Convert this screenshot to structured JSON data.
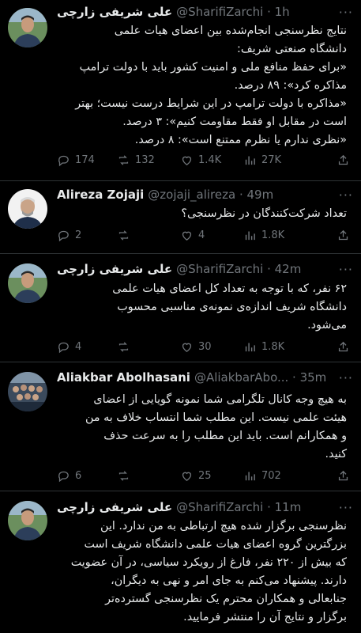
{
  "tweets": [
    {
      "name": "علی شریفی زارچی",
      "handle": "@SharifiZarchi · 1h",
      "text": "نتایج نظرسنجی انجام‌شده بین اعضای هیات علمی\nدانشگاه صنعتی شریف:\n«برای حفظ منافع ملی و امنیت کشور باید با دولت ترامپ\nمذاکره کرد»: ۸۹ درصد.\n«مذاکره با دولت ترامپ در این شرایط درست نیست؛ بهتر\nاست در مقابل او فقط مقاومت کنیم»: ۳ درصد.\n«نظری ندارم یا نظرم ممتنع است»: ۸ درصد.",
      "replies": "174",
      "retweets": "132",
      "likes": "1.4K",
      "views": "27K"
    },
    {
      "name": "Alireza Zojaji",
      "handle": "@zojaji_alireza · 49m",
      "text": "تعداد شرکت‌کنندگان در نظرسنجی؟",
      "replies": "2",
      "retweets": "",
      "likes": "4",
      "views": "1.8K"
    },
    {
      "name": "علی شریفی زارچی",
      "handle": "@SharifiZarchi · 42m",
      "text": "۶۲ نفر، که با توجه به تعداد کل اعضای هیات علمی\nدانشگاه شریف اندازه‌ی نمونه‌ی مناسبی محسوب\nمی‌شود.",
      "replies": "4",
      "retweets": "",
      "likes": "30",
      "views": "1.8K"
    },
    {
      "name": "Aliakbar Abolhasani",
      "handle": "@AliakbarAbo... · 35m",
      "text": "به هیچ وجه کانال تلگرامی شما نمونه گویایی از اعضای\nهیئت علمی نیست. این مطلب شما انتساب خلاف به من\nو همکارانم است. باید این مطلب را به سرعت حذف\nکنید.",
      "replies": "6",
      "retweets": "",
      "likes": "25",
      "views": "702"
    },
    {
      "name": "علی شریفی زارچی",
      "handle": "@SharifiZarchi · 11m",
      "text": "نظرسنجی برگزار شده هیچ ارتباطی به من ندارد. این\nبزرگترین گروه اعضای هیات علمی دانشگاه شریف است\nکه بیش از ۲۲۰ نفر، فارغ از رویکرد سیاسی، در آن عضویت\nدارند. پیشنهاد می‌کنم به جای امر و نهی به دیگران،\nجنابعالی و همکاران محترم یک نظرسنجی گسترده‌تر\nبرگزار و نتایج آن را منتشر فرمایید.",
      "replies": "",
      "retweets": "",
      "likes": "",
      "views": ""
    }
  ],
  "more_label": "···"
}
